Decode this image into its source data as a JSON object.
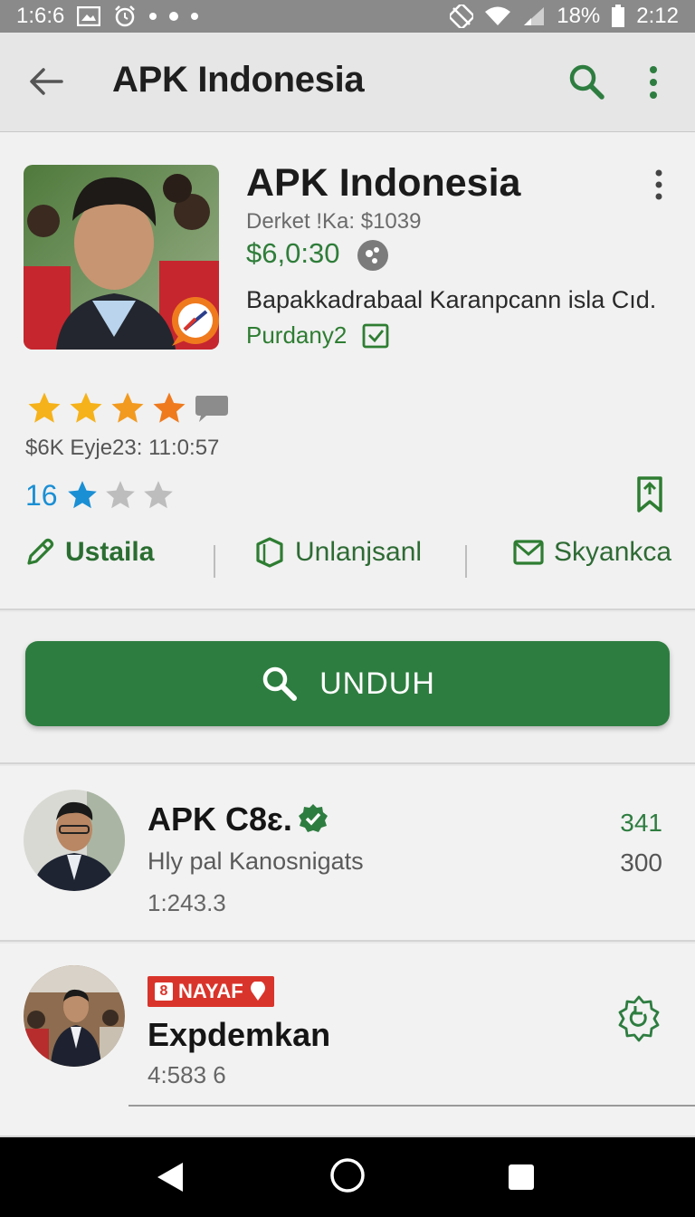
{
  "status_bar": {
    "left_time": "1:6:6",
    "battery": "18%",
    "clock": "2:12"
  },
  "app_bar": {
    "title": "APK Indonesia"
  },
  "app": {
    "title": "APK Indonesia",
    "developer_line": "Derket !Ka: $1039",
    "price": "$6,0:30",
    "description": "Bapakkadrabaal Karanpcann isla Cıd.",
    "purchase_label": "Purdany2",
    "rating_stars": 4,
    "review_meta": "$6K Eyje23: 11:0:57",
    "small_rating_count": "16",
    "small_rating_stars": 1,
    "actions": [
      {
        "label": "Ustaila",
        "icon": "pencil-icon"
      },
      {
        "label": "Unlanjsanl",
        "icon": "shield-icon"
      },
      {
        "label": "Skyankca",
        "icon": "mail-icon"
      }
    ]
  },
  "download_button": {
    "label": "UNDUH",
    "icon": "search-icon"
  },
  "list": [
    {
      "title": "APK C8ɛ.",
      "subtitle": "Hly pal Kanosnigats",
      "meta": "1:243.3",
      "right_top": "341",
      "right_bottom": "300",
      "verified": true
    },
    {
      "tag": "NAYAF",
      "tag_box": "8",
      "title": "Expdemkan",
      "meta": "4:583 6",
      "right_icon": "refresh-badge-icon"
    }
  ],
  "colors": {
    "accent": "#2e7d40",
    "tag_red": "#d9342b",
    "link_blue": "#1a8fd4",
    "star_gold": "#f6b21a",
    "star_orange": "#ef7a1e"
  }
}
